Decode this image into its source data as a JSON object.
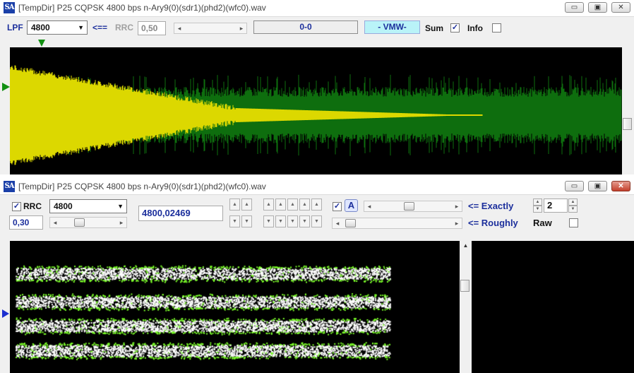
{
  "window1": {
    "title": "[TempDir] P25 CQPSK 4800 bps n-Ary9(0)(sdr1)(phd2)(wfc0).wav",
    "app_icon": "SA",
    "controls": {
      "minimize": "▭",
      "maximize": "▣",
      "close": "✕"
    },
    "toolbar": {
      "lpf_label": "LPF",
      "lpf_value": "4800",
      "arrow_label": "<==",
      "rrc_label": "RRC",
      "rrc_value": "0,50",
      "status_value": "0-0",
      "mode_value": "- VMW-",
      "sum_label": "Sum",
      "sum_checked": "✓",
      "info_label": "Info",
      "info_checked": ""
    },
    "colors": {
      "lower": "#dcd800",
      "upper": "#0e6e0e"
    }
  },
  "window2": {
    "title": "[TempDir] P25 CQPSK 4800 bps n-Ary9(0)(sdr1)(phd2)(wfc0).wav",
    "app_icon": "SA",
    "controls": {
      "minimize": "▭",
      "maximize": "▣",
      "close": "✕"
    },
    "toolbar": {
      "rrc_checked": "✓",
      "rrc_label": "RRC",
      "rrc_select": "4800",
      "rrc_value": "0,30",
      "rate_value": "4800,02469",
      "auto_checked": "✓",
      "auto_label": "A",
      "exactly_label": "<= Exactly",
      "roughly_label": "<= Roughly",
      "spin_value": "2",
      "raw_label": "Raw",
      "raw_checked": ""
    },
    "colors": {
      "dots": "#ffffff",
      "edge": "#7cff2a"
    }
  }
}
